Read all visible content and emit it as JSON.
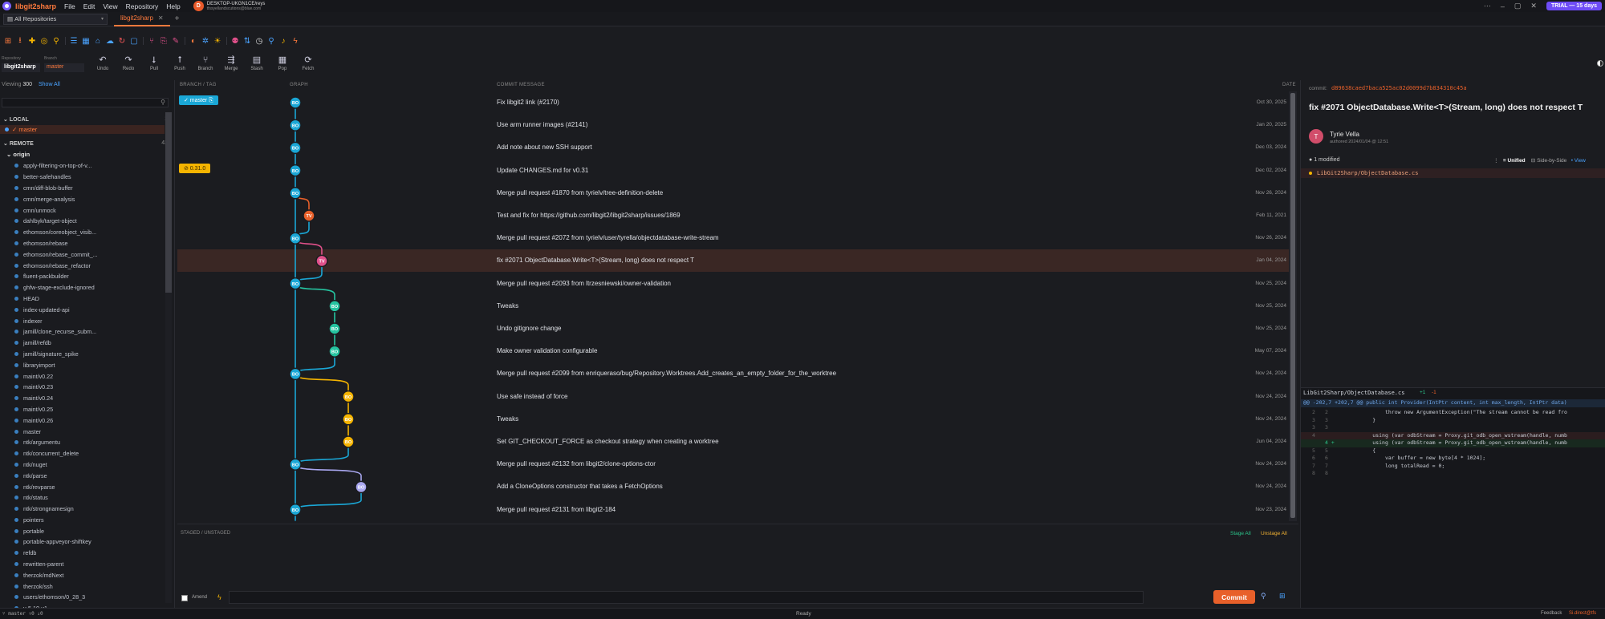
{
  "titlebar": {
    "app_name": "libgit2sharp",
    "menus": [
      "File",
      "Edit",
      "View",
      "Repository",
      "Help"
    ],
    "user_initial": "D",
    "machine": "DESKTOP-UKGN1CE/reys",
    "email": "tfssyellandscutions@blue.com",
    "trial": "TRIAL — 15 days",
    "controls": [
      "⋯",
      "–",
      "▢",
      "✕"
    ]
  },
  "tabs": {
    "repo_select": "All Repositories",
    "active_tab": "libgit2sharp"
  },
  "repo": {
    "repo_label": "Repository",
    "branch_label": "Branch",
    "name": "libgit2sharp",
    "branch": "master"
  },
  "actions": [
    {
      "icon": "↶",
      "label": "Undo"
    },
    {
      "icon": "↷",
      "label": "Redo"
    },
    {
      "icon": "⭣",
      "label": "Pull"
    },
    {
      "icon": "⭡",
      "label": "Push"
    },
    {
      "icon": "⑂",
      "label": "Branch"
    },
    {
      "icon": "⇶",
      "label": "Merge"
    },
    {
      "icon": "▤",
      "label": "Stash"
    },
    {
      "icon": "▦",
      "label": "Pop"
    },
    {
      "icon": "⟳",
      "label": "Fetch"
    }
  ],
  "sidebar": {
    "viewing_label": "Viewing",
    "viewing_count": "300",
    "show_all": "Show All",
    "local_label": "LOCAL",
    "local_count": "1",
    "local_branch": "✓ master",
    "remote_label": "REMOTE",
    "remote_count": "43",
    "origin": "origin",
    "remote_branches": [
      "apply-filtering-on-top-of-v...",
      "better-safehandles",
      "cmn/diff-blob-buffer",
      "cmn/merge-analysis",
      "cmn/unmock",
      "dahlbyk/target-object",
      "ethomson/coreobject_visib...",
      "ethomson/rebase",
      "ethomson/rebase_commit_...",
      "ethomson/rebase_refactor",
      "fluent-packbuilder",
      "ghfw-stage-exclude-ignored",
      "HEAD",
      "index-updated-api",
      "indexer",
      "jamill/clone_recurse_subm...",
      "jamill/refdb",
      "jamill/signature_spike",
      "libraryimport",
      "maint/v0.22",
      "maint/v0.23",
      "maint/v0.24",
      "maint/v0.25",
      "maint/v0.26",
      "master",
      "ntk/argumentu",
      "ntk/concurrent_delete",
      "ntk/nuget",
      "ntk/parse",
      "ntk/revparse",
      "ntk/status",
      "ntk/strongnamesign",
      "pointers",
      "portable",
      "portable-appveyor-shiftkey",
      "refdb",
      "rewritten-parent",
      "therzok/mdNext",
      "therzok/ssh",
      "users/ethomson/0_28_3",
      "v-5.10-v1"
    ]
  },
  "graph": {
    "col_branch": "BRANCH / TAG",
    "col_graph": "GRAPH",
    "col_message": "COMMIT MESSAGE",
    "col_date": "DATE",
    "rows": [
      {
        "message": "Fix libgit2 link (#2170)",
        "date": "Oct 30, 2025",
        "tag": "✓ master ⎘"
      },
      {
        "message": "Use arm runner images (#2141)",
        "date": "Jan 20, 2025",
        "tag": ""
      },
      {
        "message": "Add note about new SSH support",
        "date": "Dec 03, 2024",
        "tag": ""
      },
      {
        "message": "Update CHANGES.md for v0.31",
        "date": "Dec 02, 2024",
        "tag": "⊘ 0.31.0"
      },
      {
        "message": "Merge pull request #1870 from tyrielv/tree-definition-delete",
        "date": "Nov 26, 2024",
        "tag": ""
      },
      {
        "message": "Test and fix for https://github.com/libgit2/libgit2sharp/issues/1869",
        "date": "Feb 11, 2021",
        "tag": ""
      },
      {
        "message": "Merge pull request #2072 from tyrielv/user/tyrella/objectdatabase-write-stream",
        "date": "Nov 26, 2024",
        "tag": ""
      },
      {
        "message": "fix #2071 ObjectDatabase.Write<T>(Stream, long) does not respect T",
        "date": "Jan 04, 2024",
        "tag": ""
      },
      {
        "message": "Merge pull request #2093 from ltrzesniewski/owner-validation",
        "date": "Nov 25, 2024",
        "tag": ""
      },
      {
        "message": "Tweaks",
        "date": "Nov 25, 2024",
        "tag": ""
      },
      {
        "message": "Undo gitignore change",
        "date": "Nov 25, 2024",
        "tag": ""
      },
      {
        "message": "Make owner validation configurable",
        "date": "May 07, 2024",
        "tag": ""
      },
      {
        "message": "Merge pull request #2099 from enriqueraso/bug/Repository.Worktrees.Add_creates_an_empty_folder_for_the_worktree",
        "date": "Nov 24, 2024",
        "tag": ""
      },
      {
        "message": "Use safe instead of force",
        "date": "Nov 24, 2024",
        "tag": ""
      },
      {
        "message": "Tweaks",
        "date": "Nov 24, 2024",
        "tag": ""
      },
      {
        "message": "Set GIT_CHECKOUT_FORCE as checkout strategy when creating a worktree",
        "date": "Jun 04, 2024",
        "tag": ""
      },
      {
        "message": "Merge pull request #2132 from libgit2/clone-options-ctor",
        "date": "Nov 24, 2024",
        "tag": ""
      },
      {
        "message": "Add a CloneOptions constructor that takes a FetchOptions",
        "date": "Nov 24, 2024",
        "tag": ""
      },
      {
        "message": "Merge pull request #2131 from libgit2-184",
        "date": "Nov 23, 2024",
        "tag": ""
      }
    ],
    "nodes": [
      [
        "BO",
        0
      ],
      [
        "BO",
        0
      ],
      [
        "BO",
        0
      ],
      [
        "BO",
        0
      ],
      [
        "BO",
        0
      ],
      [
        "TV",
        1
      ],
      [
        "BO",
        0
      ],
      [
        "TV",
        2
      ],
      [
        "BO",
        0
      ],
      [
        "BO",
        3
      ],
      [
        "BO",
        3
      ],
      [
        "BO",
        3
      ],
      [
        "BO",
        0
      ],
      [
        "BO",
        4
      ],
      [
        "BO",
        4
      ],
      [
        "BO",
        4
      ],
      [
        "BO",
        0
      ],
      [
        "BO",
        5
      ],
      [
        "BO",
        0
      ]
    ],
    "lane_colors": [
      "#1aa7d6",
      "#e8602a",
      "#e0508a",
      "#25c4a0",
      "#f5b400",
      "#a9a7f0"
    ]
  },
  "staged": {
    "title": "STAGED / UNSTAGED",
    "stage_all": "Stage All",
    "unstage_all": "Unstage All",
    "amend": "Amend",
    "commit": "Commit"
  },
  "details": {
    "commit_label": "commit:",
    "commit_id": "d89638caed7baca525ac02d0099d7b834310c45a",
    "title": "fix #2071 ObjectDatabase.Write<T>(Stream, long) does not respect T",
    "author_initial": "T",
    "author": "Tyrie Vella",
    "author_date": "authored 2024/01/04 @ 12:51",
    "modified": "1 modified",
    "unified": "Unified",
    "side": "Side-by-Side",
    "view": "View",
    "file": "LibGit2Sharp/ObjectDatabase.cs"
  },
  "diff": {
    "file": "LibGit2Sharp/ObjectDatabase.cs",
    "add": "+1",
    "del": "-1",
    "hunk": "@@ -202,7 +202,7 @@ public int Provider(IntPtr content, int max_length, IntPtr data)",
    "lines": [
      {
        "n1": "2",
        "n2": "2",
        "code": "            throw new ArgumentException(\"The stream cannot be read fro",
        "type": ""
      },
      {
        "n1": "3",
        "n2": "3",
        "code": "        }",
        "type": ""
      },
      {
        "n1": "3",
        "n2": "3",
        "code": "",
        "type": ""
      },
      {
        "n1": "4",
        "n2": "",
        "code": "        using (var odbStream = Proxy.git_odb_open_wstream(handle, numb",
        "type": "del"
      },
      {
        "n1": "",
        "n2": "4 +",
        "code": "        using (var odbStream = Proxy.git_odb_open_wstream(handle, numb",
        "type": "add"
      },
      {
        "n1": "5",
        "n2": "5",
        "code": "        {",
        "type": ""
      },
      {
        "n1": "6",
        "n2": "6",
        "code": "            var buffer = new byte[4 * 1024];",
        "type": ""
      },
      {
        "n1": "7",
        "n2": "7",
        "code": "            long totalRead = 0;",
        "type": ""
      },
      {
        "n1": "8",
        "n2": "8",
        "code": "",
        "type": ""
      }
    ]
  },
  "status": {
    "branch": "⑂ master ↑0 ↓0",
    "ready": "Ready",
    "feedback": "Feedback",
    "user": "Si.direct@tfs"
  }
}
